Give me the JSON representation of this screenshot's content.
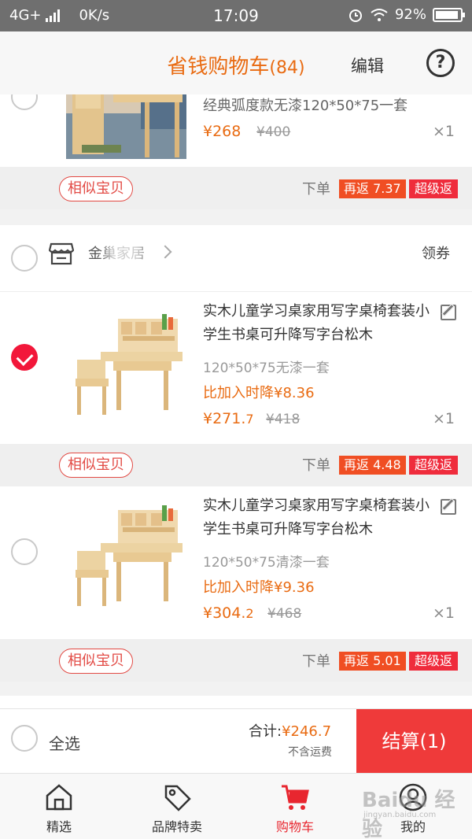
{
  "status_bar": {
    "network": "4G+",
    "speed": "0K/s",
    "time": "17:09",
    "battery": "92%",
    "battery_level": 0.92
  },
  "header": {
    "title": "省钱购物车",
    "count": "(84)",
    "edit_label": "编辑",
    "help_label": "?"
  },
  "items_top": {
    "spec": "经典弧度款无漆120*50*75一套",
    "price": "¥268",
    "orig_price": "¥400",
    "qty": "×1",
    "similar_label": "相似宝贝",
    "order_label": "下单",
    "rebate_label": "再返 7.37",
    "super_label": "超级返"
  },
  "shop": {
    "name": "金巢家居",
    "coupon_label": "领券"
  },
  "items": [
    {
      "checked": true,
      "name": "实木儿童学习桌家用写字桌椅套装小学生书桌可升降写字台松木",
      "spec": "120*50*75无漆一套",
      "drop": "比加入时降¥8.36",
      "price_main": "¥271.",
      "price_small": "7",
      "orig_price": "¥418",
      "qty": "×1",
      "similar_label": "相似宝贝",
      "order_label": "下单",
      "rebate_label": "再返 4.48",
      "super_label": "超级返"
    },
    {
      "checked": false,
      "name": "实木儿童学习桌家用写字桌椅套装小学生书桌可升降写字台松木",
      "spec": "120*50*75清漆一套",
      "drop": "比加入时降¥9.36",
      "price_main": "¥304.",
      "price_small": "2",
      "orig_price": "¥468",
      "qty": "×1",
      "similar_label": "相似宝贝",
      "order_label": "下单",
      "rebate_label": "再返 5.01",
      "super_label": "超级返"
    }
  ],
  "checkout": {
    "select_all_label": "全选",
    "total_label": "合计:",
    "total_amount": "¥246.7",
    "shipping_note": "不含运费",
    "settle_label": "结算(1)"
  },
  "tabs": [
    {
      "label": "精选",
      "icon": "home-icon",
      "active": false
    },
    {
      "label": "品牌特卖",
      "icon": "tag-icon",
      "active": false
    },
    {
      "label": "购物车",
      "icon": "cart-icon",
      "active": true
    },
    {
      "label": "我的",
      "icon": "user-icon",
      "active": false
    }
  ],
  "watermark": {
    "text": "Baidu 经验",
    "sub": "jingyan.baidu.com"
  },
  "colors": {
    "accent": "#e96b12",
    "red": "#ef3a3a",
    "check": "#f2173a"
  }
}
